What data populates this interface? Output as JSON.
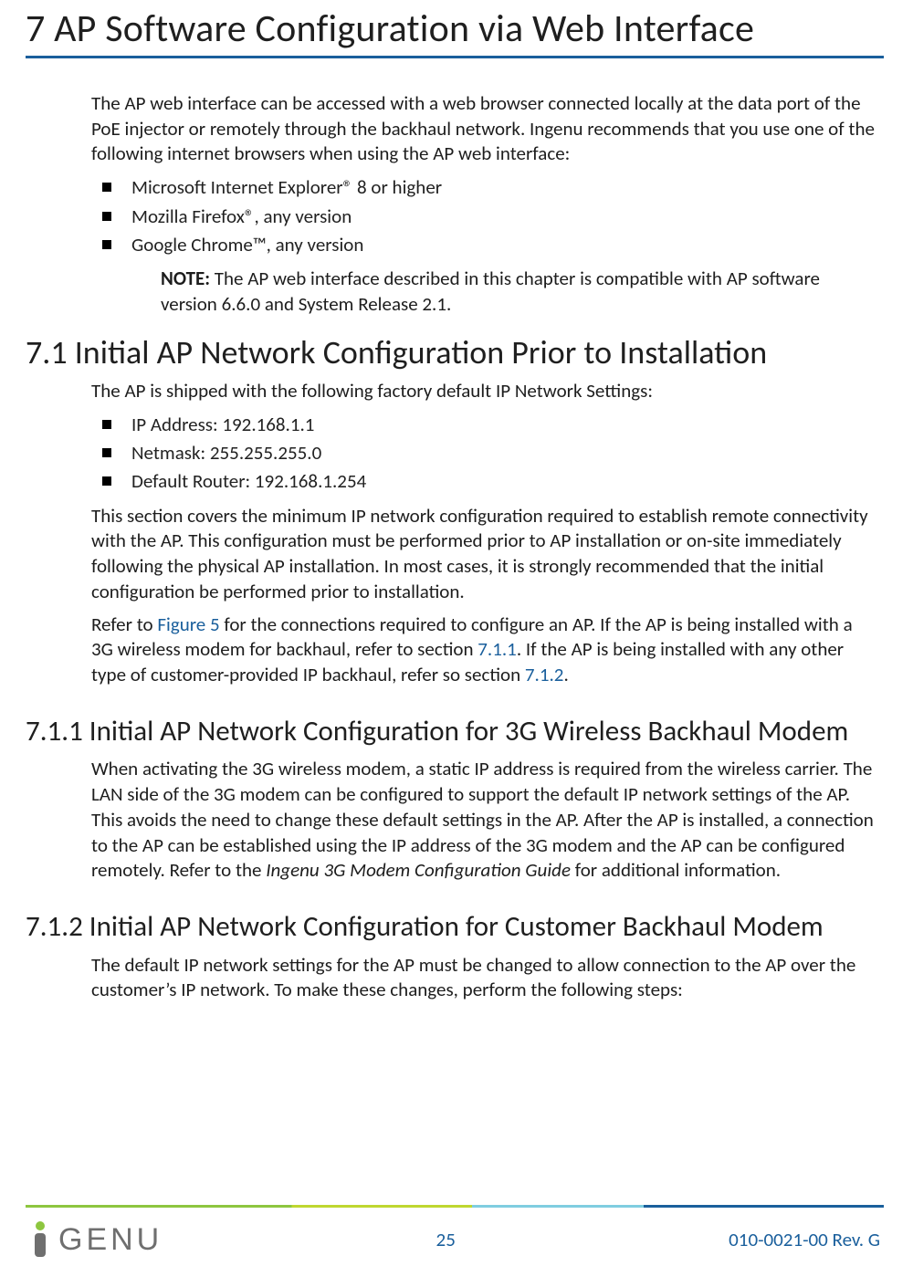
{
  "chapter": {
    "title": "7 AP Software Configuration via Web Interface"
  },
  "intro": {
    "para": "The AP web interface can be accessed with a web browser connected locally at the data port of the PoE injector or remotely through the backhaul network. Ingenu recommends that you use one of the following internet browsers when using the AP web interface:",
    "browsers": [
      "Microsoft Internet Explorer® 8 or higher",
      "Mozilla Firefox®, any version",
      "Google Chrome™, any version"
    ],
    "note_label": "NOTE:",
    "note_text": "  The AP web interface described in this chapter is compatible with AP software version 6.6.0 and System Release 2.1."
  },
  "sec71": {
    "heading": "7.1 Initial AP Network Configuration Prior to Installation",
    "lead": "The AP is shipped with the following factory default IP Network Settings:",
    "defaults": [
      "IP Address: 192.168.1.1",
      "Netmask: 255.255.255.0",
      "Default Router: 192.168.1.254"
    ],
    "para2": "This section covers the minimum IP network configuration required to establish remote connectivity with the AP. This configuration must be performed prior to AP installation or on-site immediately following the physical AP installation. In most cases, it is strongly recommended that the initial configuration be performed prior to installation.",
    "para3_pre": "Refer to ",
    "xref1": "Figure 5",
    "para3_mid1": " for the connections required to configure an AP. If the AP is being installed with a 3G wireless modem for backhaul, refer to section ",
    "xref2": "7.1.1",
    "para3_mid2": ". If the AP is being installed with any other type of customer-provided IP backhaul, refer so section ",
    "xref3": "7.1.2",
    "para3_end": "."
  },
  "sec711": {
    "heading": "7.1.1 Initial AP Network Configuration for 3G Wireless Backhaul Modem",
    "para_pre": "When activating the 3G wireless modem, a static IP address is required from the wireless carrier. The LAN side of the 3G modem can be configured to support the default IP network settings of the AP. This avoids the need to change these default settings in the AP. After the AP is installed, a connection to the AP can be established using the IP address of the 3G modem and the AP can be configured remotely. Refer to the ",
    "doc_title": "Ingenu 3G Modem Configuration Guide",
    "para_post": " for additional information."
  },
  "sec712": {
    "heading": "7.1.2 Initial AP Network Configuration for Customer Backhaul Modem",
    "para": "The default IP network settings for the AP must be changed to allow connection to the AP over the customer’s IP network. To make these changes, perform the following steps:"
  },
  "footer": {
    "page_number": "25",
    "doc_id": "010-0021-00 Rev. G",
    "logo_text": "GENU"
  }
}
